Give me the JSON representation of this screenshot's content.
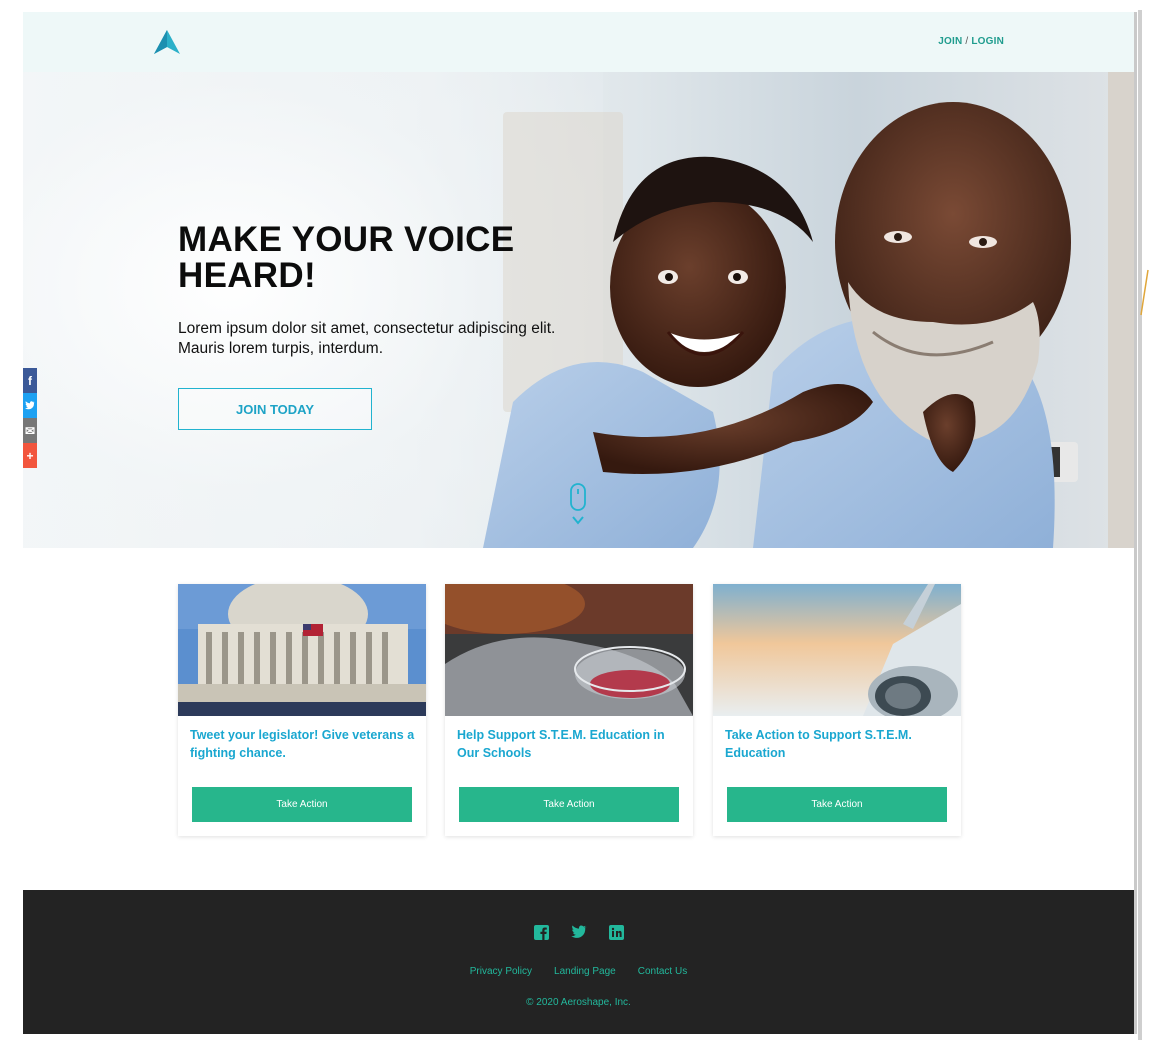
{
  "header": {
    "logo_icon": "chevron-up-icon",
    "join_label": "JOIN",
    "separator": "/",
    "login_label": "LOGIN"
  },
  "hero": {
    "title_line1": "MAKE YOUR VOICE",
    "title_line2": "HEARD!",
    "subtitle_line1": "Lorem ipsum dolor sit amet, consectetur adipiscing elit.",
    "subtitle_line2": "Mauris lorem turpis, interdum.",
    "cta_label": "JOIN TODAY"
  },
  "share_bar": {
    "items": [
      {
        "icon": "facebook-icon",
        "glyph": "f",
        "color": "#3b5998"
      },
      {
        "icon": "twitter-icon",
        "glyph": "t",
        "color": "#1da1f2"
      },
      {
        "icon": "email-icon",
        "glyph": "✉",
        "color": "#777777"
      },
      {
        "icon": "plus-icon",
        "glyph": "+",
        "color": "#f2553d"
      }
    ]
  },
  "cards": [
    {
      "title": "Tweet your legislator! Give veterans a fighting chance.",
      "button": "Take Action"
    },
    {
      "title": "Help Support S.T.E.M. Education in Our Schools",
      "button": "Take Action"
    },
    {
      "title": "Take Action to Support S.T.E.M. Education",
      "button": "Take Action"
    }
  ],
  "footer": {
    "social_icons": [
      "facebook-icon",
      "twitter-icon",
      "linkedin-icon"
    ],
    "links": [
      "Privacy Policy",
      "Landing Page",
      "Contact Us"
    ],
    "copyright": "© 2020 Aeroshape, Inc."
  },
  "colors": {
    "accent_teal": "#27b68c",
    "link_blue": "#1aa7d0",
    "header_bg": "#eef8f8",
    "footer_bg": "#232323"
  }
}
